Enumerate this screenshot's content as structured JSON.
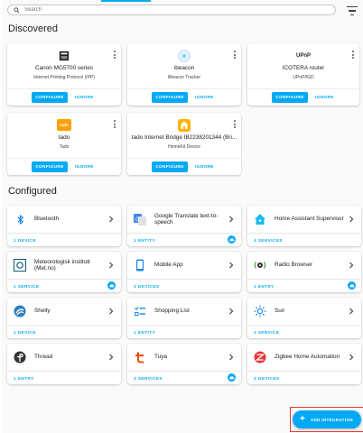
{
  "search": {
    "placeholder": "Search"
  },
  "sections": {
    "discovered": "Discovered",
    "configured": "Configured"
  },
  "discovered": [
    {
      "name": "Canon MG5700 series",
      "subtitle": "Internet Printing Protocol (IPP)",
      "icon": "printer-icon",
      "configure": "CONFIGURE",
      "ignore": "IGNORE"
    },
    {
      "name": "ibeacon",
      "subtitle": "iBeacon Tracker",
      "icon": "ibeacon-icon",
      "configure": "CONFIGURE",
      "ignore": "IGNORE"
    },
    {
      "name": "ICOTERA router",
      "subtitle": "UPnP/IGD",
      "icon": "upnp-icon",
      "logo_text": "UPnP",
      "configure": "CONFIGURE",
      "ignore": "IGNORE"
    },
    {
      "name": "tado",
      "subtitle": "Tado",
      "icon": "tado-icon",
      "logo_text": "tado",
      "configure": "CONFIGURE",
      "ignore": "IGNORE"
    },
    {
      "name": "tado Internet Bridge IB2238201344 (Bri...",
      "subtitle": "HomeKit Device",
      "icon": "homekit-icon",
      "configure": "CONFIGURE",
      "ignore": "IGNORE"
    }
  ],
  "configured": [
    {
      "title": "Bluetooth",
      "count": "1 DEVICE",
      "icon": "bluetooth-icon",
      "cloud": false
    },
    {
      "title": "Google Translate text-to-speech",
      "count": "1 ENTITY",
      "icon": "google-translate-icon",
      "cloud": true
    },
    {
      "title": "Home Assistant Supervisor",
      "count": "4 SERVICES",
      "icon": "home-assistant-icon",
      "cloud": false
    },
    {
      "title": "Meteorologisk institutt (Met.no)",
      "count": "1 SERVICE",
      "icon": "met-no-icon",
      "cloud": true
    },
    {
      "title": "Mobile App",
      "count": "3 DEVICES",
      "icon": "mobile-app-icon",
      "cloud": false
    },
    {
      "title": "Radio Browser",
      "count": "1 ENTRY",
      "icon": "radio-browser-icon",
      "cloud": true
    },
    {
      "title": "Shelly",
      "count": "1 DEVICE",
      "icon": "shelly-icon",
      "cloud": false
    },
    {
      "title": "Shopping List",
      "count": "1 ENTITY",
      "icon": "shopping-list-icon",
      "cloud": false
    },
    {
      "title": "Sun",
      "count": "1 SERVICE",
      "icon": "sun-icon",
      "cloud": false
    },
    {
      "title": "Thread",
      "count": "1 ENTRY",
      "icon": "thread-icon",
      "cloud": false
    },
    {
      "title": "Tuya",
      "count": "3 SERVICES",
      "icon": "tuya-icon",
      "cloud": true
    },
    {
      "title": "Zigbee Home Automation",
      "count": "3 DEVICES",
      "icon": "zigbee-icon",
      "cloud": false
    }
  ],
  "fab": {
    "label": "ADD INTEGRATION",
    "icon": "plus-icon"
  },
  "colors": {
    "accent": "#03a9f4",
    "highlight": "#e53935"
  }
}
